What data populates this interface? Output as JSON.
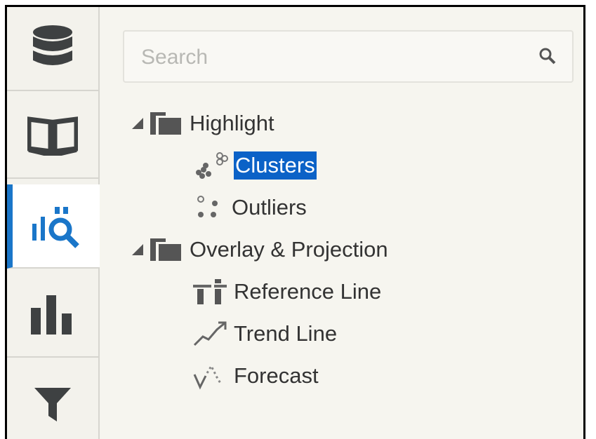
{
  "search": {
    "placeholder": "Search"
  },
  "rail": {
    "tabs": [
      {
        "icon": "database-icon",
        "active": false
      },
      {
        "icon": "book-icon",
        "active": false
      },
      {
        "icon": "analytics-icon",
        "active": true
      },
      {
        "icon": "bar-chart-icon",
        "active": false
      },
      {
        "icon": "filter-icon",
        "active": false
      }
    ]
  },
  "tree": {
    "groups": [
      {
        "label": "Highlight",
        "expanded": true,
        "items": [
          {
            "label": "Clusters",
            "icon": "clusters-icon",
            "selected": true
          },
          {
            "label": "Outliers",
            "icon": "outliers-icon",
            "selected": false
          }
        ]
      },
      {
        "label": "Overlay & Projection",
        "expanded": true,
        "items": [
          {
            "label": "Reference Line",
            "icon": "reference-line-icon",
            "selected": false
          },
          {
            "label": "Trend Line",
            "icon": "trend-line-icon",
            "selected": false
          },
          {
            "label": "Forecast",
            "icon": "forecast-icon",
            "selected": false
          }
        ]
      }
    ]
  },
  "colors": {
    "accent": "#1a76c9",
    "selection": "#0b62c7",
    "icon": "#3e4142",
    "panel": "#f6f5ef"
  }
}
